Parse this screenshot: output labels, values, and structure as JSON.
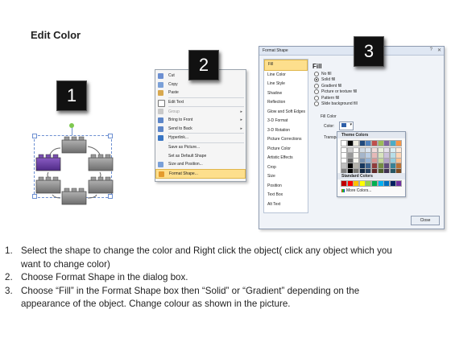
{
  "title": "Edit Color",
  "badges": [
    "1",
    "2",
    "3"
  ],
  "context_menu": {
    "items": [
      {
        "label": "Cut",
        "icon": "scissors-icon"
      },
      {
        "label": "Copy",
        "icon": "copy-icon"
      },
      {
        "label": "Paste",
        "icon": "paste-icon"
      },
      {
        "label": "Edit Text",
        "icon": "edit-text-icon"
      },
      {
        "label": "Group",
        "icon": "group-icon",
        "submenu": true
      },
      {
        "label": "Bring to Front",
        "icon": "bring-front-icon",
        "submenu": true
      },
      {
        "label": "Send to Back",
        "icon": "send-back-icon",
        "submenu": true
      },
      {
        "label": "Hyperlink...",
        "icon": "hyperlink-icon"
      },
      {
        "label": "Save as Picture...",
        "icon": "save-picture-icon"
      },
      {
        "label": "Set as Default Shape",
        "icon": "default-shape-icon"
      },
      {
        "label": "Size and Position...",
        "icon": "size-position-icon"
      },
      {
        "label": "Format Shape...",
        "icon": "format-shape-icon",
        "highlighted": true
      }
    ]
  },
  "dialog": {
    "title": "Format Shape",
    "categories": [
      "Fill",
      "Line Color",
      "Line Style",
      "Shadow",
      "Reflection",
      "Glow and Soft Edges",
      "3-D Format",
      "3-D Rotation",
      "Picture Corrections",
      "Picture Color",
      "Artistic Effects",
      "Crop",
      "Size",
      "Position",
      "Text Box",
      "Alt Text"
    ],
    "fill_heading": "Fill",
    "options": [
      "No fill",
      "Solid fill",
      "Gradient fill",
      "Picture or texture fill",
      "Pattern fill",
      "Slide background fill"
    ],
    "fill_color_label": "Fill Color",
    "color_label": "Color:",
    "transparency_label": "Transpa",
    "close_button": "Close",
    "palette": {
      "theme_heading": "Theme Colors",
      "standard_heading": "Standard Colors",
      "more_colors": "More Colors...",
      "theme_columns": [
        "#ffffff",
        "#000000",
        "#eeece1",
        "#1f497d",
        "#4f81bd",
        "#c0504d",
        "#9bbb59",
        "#8064a2",
        "#4bacc6",
        "#f79646"
      ],
      "standard_colors": [
        "#c00000",
        "#ff0000",
        "#ffc000",
        "#ffff00",
        "#92d050",
        "#00b050",
        "#00b0f0",
        "#0070c0",
        "#002060",
        "#7030a0"
      ]
    }
  },
  "instructions": [
    {
      "num": "1.",
      "lines": [
        "Select the shape to change the color and Right click the object( click any object which you",
        "want to change color)"
      ]
    },
    {
      "num": "2.",
      "lines": [
        "Choose Format Shape in the dialog box."
      ]
    },
    {
      "num": "3.",
      "lines": [
        "Choose “Fill” in the Format Shape box then “Solid” or “Gradient” depending on the",
        "appearance of the object. Change colour as shown in the picture."
      ]
    }
  ],
  "colors": {
    "selected_brick": "#6a3fa0",
    "brick": "#8c8c8c",
    "highlight": "#fddf8d",
    "badge_bg": "#111111"
  }
}
